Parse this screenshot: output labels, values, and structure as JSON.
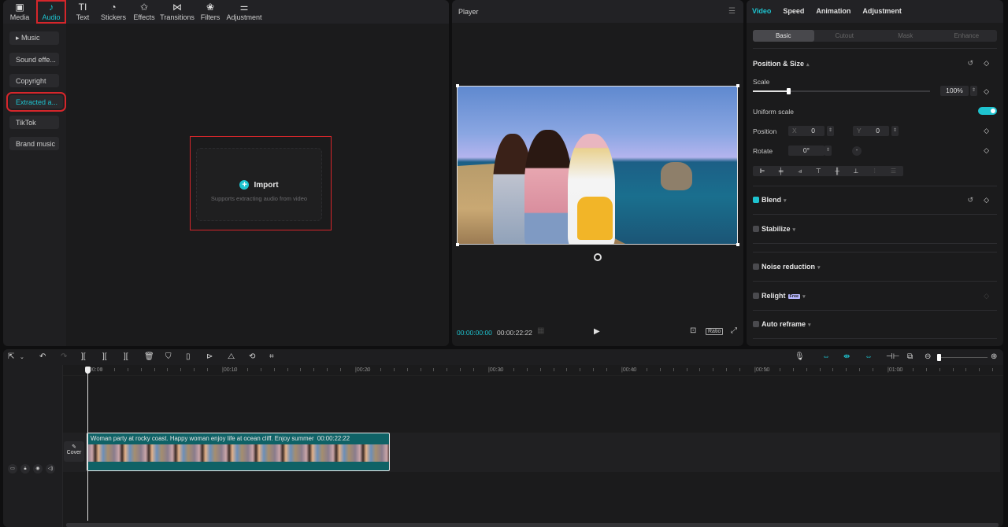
{
  "media_panel": {
    "tabs": [
      {
        "label": "Media",
        "icon": "media-icon",
        "glyph": "▣"
      },
      {
        "label": "Audio",
        "icon": "audio-icon",
        "glyph": "♪",
        "active": true
      },
      {
        "label": "Text",
        "icon": "text-icon",
        "glyph": "TI"
      },
      {
        "label": "Stickers",
        "icon": "stickers-icon",
        "glyph": "◔"
      },
      {
        "label": "Effects",
        "icon": "effects-icon",
        "glyph": "✩"
      },
      {
        "label": "Transitions",
        "icon": "transitions-icon",
        "glyph": "⋈"
      },
      {
        "label": "Filters",
        "icon": "filters-icon",
        "glyph": "❀"
      },
      {
        "label": "Adjustment",
        "icon": "adjustment-icon",
        "glyph": "⚌"
      }
    ],
    "categories": [
      {
        "label": "▸ Music"
      },
      {
        "label": "Sound effe..."
      },
      {
        "label": "Copyright"
      },
      {
        "label": "Extracted a...",
        "active": true
      },
      {
        "label": "TikTok"
      },
      {
        "label": "Brand music"
      }
    ],
    "import": {
      "label": "Import",
      "subtitle": "Supports extracting audio from video"
    }
  },
  "player": {
    "title": "Player",
    "current_time": "00:00:00:00",
    "duration": "00:00:22:22",
    "ratio_label": "Ratio"
  },
  "inspector": {
    "tabs": [
      "Video",
      "Speed",
      "Animation",
      "Adjustment"
    ],
    "active_tab": "Video",
    "subtabs": [
      "Basic",
      "Cutout",
      "Mask",
      "Enhance"
    ],
    "active_subtab": "Basic",
    "position_size": {
      "title": "Position & Size",
      "scale_label": "Scale",
      "scale_value": "100%",
      "scale_fraction": 0.2,
      "uniform_scale_label": "Uniform scale",
      "uniform_scale_on": true,
      "position_label": "Position",
      "x_label": "X",
      "x_value": "0",
      "y_label": "Y",
      "y_value": "0",
      "rotate_label": "Rotate",
      "rotate_value": "0°"
    },
    "sections": [
      {
        "label": "Blend",
        "checked": true
      },
      {
        "label": "Stabilize",
        "checked": false
      },
      {
        "label": "Noise reduction",
        "checked": false
      },
      {
        "label": "Relight",
        "checked": false,
        "badge": "Free"
      },
      {
        "label": "Auto reframe",
        "checked": false
      }
    ]
  },
  "timeline": {
    "ruler_labels": [
      "00:00",
      "00:10",
      "00:20",
      "00:30",
      "00:40",
      "00:50",
      "01:00"
    ],
    "clip": {
      "title": "Woman party at rocky coast. Happy woman enjoy life at ocean cliff. Enjoy summer",
      "duration": "00:00:22:22"
    },
    "cover_label": "Cover"
  }
}
